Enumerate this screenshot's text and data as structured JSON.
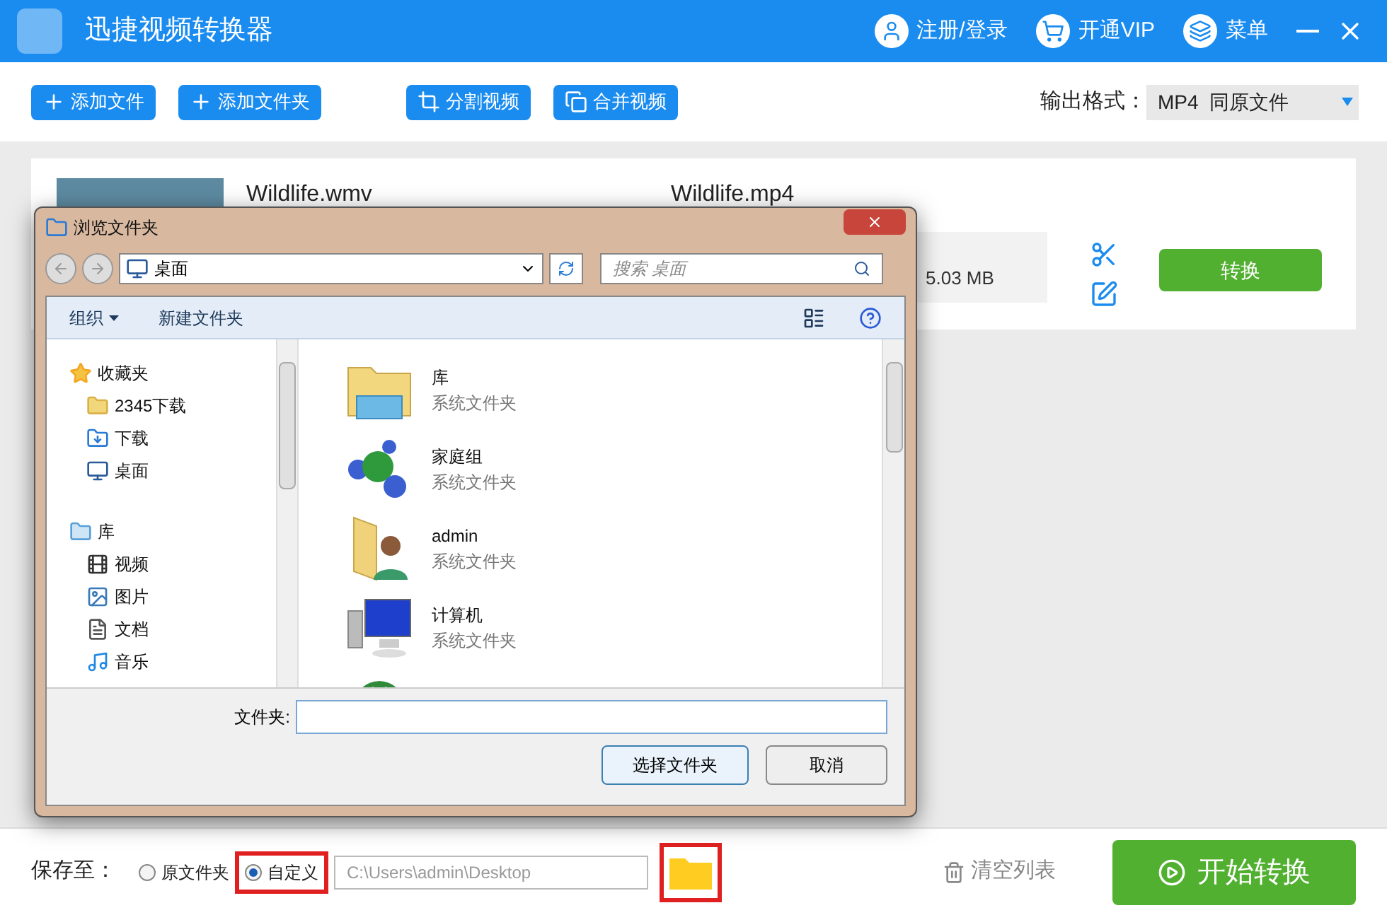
{
  "app": {
    "title": "迅捷视频转换器",
    "header_actions": [
      {
        "kind": "user",
        "label": "注册/登录"
      },
      {
        "kind": "cart",
        "label": "开通VIP"
      },
      {
        "kind": "layers",
        "label": "菜单"
      }
    ]
  },
  "toolbar": {
    "buttons": [
      {
        "kind": "plus",
        "label": "添加文件"
      },
      {
        "kind": "plus",
        "label": "添加文件夹"
      },
      {
        "kind": "crop",
        "label": "分割视频"
      },
      {
        "kind": "merge",
        "label": "合并视频"
      }
    ],
    "format_label": "输出格式：",
    "format_value": "MP4  同原文件"
  },
  "file_item": {
    "source_name": "Wildlife.wmv",
    "output_name": "Wildlife.mp4",
    "size": "5.03 MB",
    "convert_button": "转换"
  },
  "dialog": {
    "title": "浏览文件夹",
    "address": "桌面",
    "search_placeholder": "搜索 桌面",
    "organize": "组织",
    "new_folder": "新建文件夹",
    "nav": [
      {
        "kind": "star",
        "label": "收藏夹",
        "children": [
          {
            "kind": "folder",
            "label": "2345下载"
          },
          {
            "kind": "download",
            "label": "下载"
          },
          {
            "kind": "desktop",
            "label": "桌面"
          }
        ]
      },
      {
        "kind": "library",
        "label": "库",
        "children": [
          {
            "kind": "video",
            "label": "视频"
          },
          {
            "kind": "picture",
            "label": "图片"
          },
          {
            "kind": "doc",
            "label": "文档"
          },
          {
            "kind": "music",
            "label": "音乐"
          }
        ]
      }
    ],
    "items": [
      {
        "kind": "library",
        "name": "库",
        "type": "系统文件夹"
      },
      {
        "kind": "homegroup",
        "name": "家庭组",
        "type": "系统文件夹"
      },
      {
        "kind": "user",
        "name": "admin",
        "type": "系统文件夹"
      },
      {
        "kind": "computer",
        "name": "计算机",
        "type": "系统文件夹"
      },
      {
        "kind": "network"
      }
    ],
    "folder_label": "文件夹:",
    "ok": "选择文件夹",
    "cancel": "取消"
  },
  "bottom": {
    "save_label": "保存至：",
    "options": [
      {
        "label": "原文件夹",
        "selected": false
      },
      {
        "label": "自定义",
        "selected": true
      }
    ],
    "path": "C:\\Users\\admin\\Desktop",
    "clear": "清空列表",
    "start": "开始转换"
  }
}
